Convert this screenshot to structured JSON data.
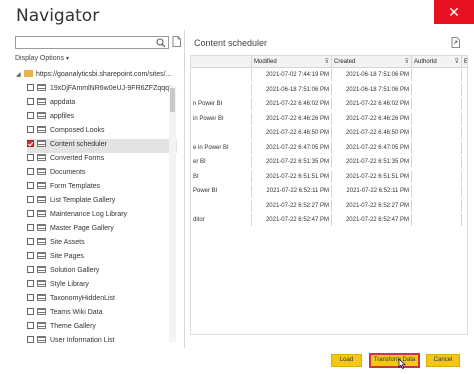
{
  "window": {
    "title": "Navigator",
    "close_label": "✕"
  },
  "search": {
    "placeholder": ""
  },
  "display_options": {
    "label": "Display Options",
    "caret": "▾"
  },
  "tree": {
    "root": {
      "expand": "◢",
      "label": "https://goanalyticsbi.sharepoint.com/sites/..."
    },
    "items": [
      {
        "label": "19xDjFAmmlNR6w0eUJ-9FR6ZFZqqqt...",
        "checked": false
      },
      {
        "label": "appdata",
        "checked": false
      },
      {
        "label": "appfiles",
        "checked": false
      },
      {
        "label": "Composed Looks",
        "checked": false
      },
      {
        "label": "Content scheduler",
        "checked": true
      },
      {
        "label": "Converted Forms",
        "checked": false
      },
      {
        "label": "Documents",
        "checked": false
      },
      {
        "label": "Form Templates",
        "checked": false
      },
      {
        "label": "List Template Gallery",
        "checked": false
      },
      {
        "label": "Maintenance Log Library",
        "checked": false
      },
      {
        "label": "Master Page Gallery",
        "checked": false
      },
      {
        "label": "Site Assets",
        "checked": false
      },
      {
        "label": "Site Pages",
        "checked": false
      },
      {
        "label": "Solution Gallery",
        "checked": false
      },
      {
        "label": "Style Library",
        "checked": false
      },
      {
        "label": "TaxonomyHiddenList",
        "checked": false
      },
      {
        "label": "Teams Wiki Data",
        "checked": false
      },
      {
        "label": "Theme Gallery",
        "checked": false
      },
      {
        "label": "User Information List",
        "checked": false
      }
    ]
  },
  "preview": {
    "title": "Content scheduler",
    "columns": [
      "",
      "Modified",
      "Created",
      "AuthorId",
      "Ed"
    ],
    "sort_glyph": "⊽",
    "rows": [
      [
        "",
        "2021-07-02 7:44:19 PM",
        "2021-06-18 7:51:06 PM",
        "",
        ""
      ],
      [
        "",
        "2021-06-18 7:51:06 PM",
        "2021-06-18 7:51:06 PM",
        "",
        ""
      ],
      [
        "n Power BI",
        "2021-07-22 6:46:02 PM",
        "2021-07-22 6:46:02 PM",
        "",
        ""
      ],
      [
        "in Power BI",
        "2021-07-22 6:46:26 PM",
        "2021-07-22 6:46:26 PM",
        "",
        ""
      ],
      [
        "",
        "2021-07-22 6:46:50 PM",
        "2021-07-22 6:46:50 PM",
        "",
        ""
      ],
      [
        "e in Power BI",
        "2021-07-22 6:47:05 PM",
        "2021-07-22 6:47:05 PM",
        "",
        ""
      ],
      [
        "er BI",
        "2021-07-22 6:51:35 PM",
        "2021-07-22 6:51:35 PM",
        "",
        ""
      ],
      [
        "BI",
        "2021-07-22 6:51:51 PM",
        "2021-07-22 6:51:51 PM",
        "",
        ""
      ],
      [
        "Power BI",
        "2021-07-22 6:52:11 PM",
        "2021-07-22 6:52:11 PM",
        "",
        ""
      ],
      [
        "",
        "2021-07-22 6:52:27 PM",
        "2021-07-22 6:52:27 PM",
        "",
        ""
      ],
      [
        "ditor",
        "2021-07-22 6:52:47 PM",
        "2021-07-22 6:52:47 PM",
        "",
        ""
      ]
    ]
  },
  "buttons": {
    "load": "Load",
    "transform": "Transform Data",
    "cancel": "Cancel"
  },
  "colors": {
    "accent": "#f2c811",
    "highlight": "#d13438",
    "close": "#e81123"
  },
  "icons": [
    "search-icon",
    "open-navigator-icon",
    "export-icon",
    "folder-icon",
    "table-icon",
    "checkbox-icon",
    "mouse-pointer-icon"
  ]
}
